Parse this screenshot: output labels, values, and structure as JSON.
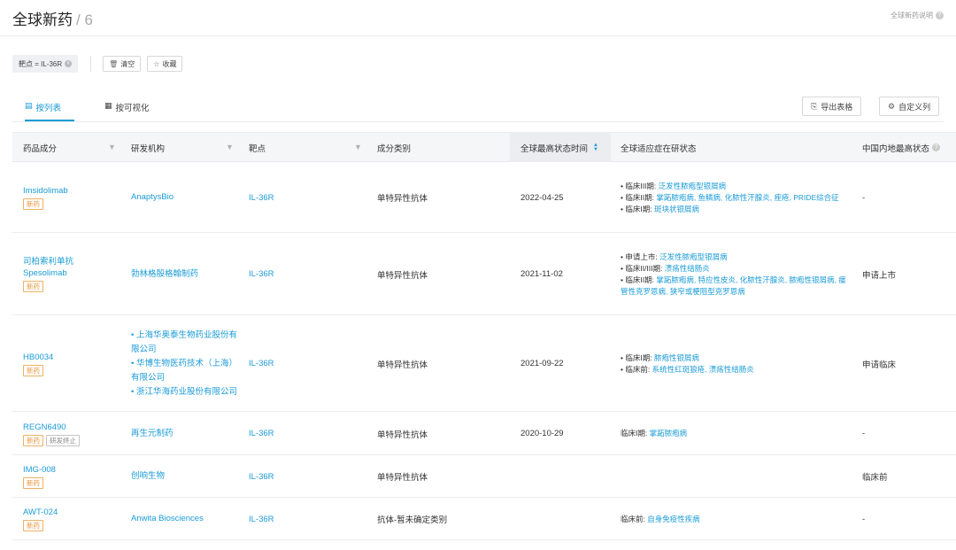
{
  "header": {
    "title": "全球新药",
    "count": "/ 6",
    "help": "全球新药说明"
  },
  "filters": {
    "chip": "靶点 = IL-36R",
    "clear": "清空",
    "save": "收藏"
  },
  "tabs": [
    {
      "label": "按列表"
    },
    {
      "label": "按可视化"
    }
  ],
  "toolbar": {
    "export": "导出表格",
    "custom_columns": "自定义列"
  },
  "columns": [
    "药品成分",
    "研发机构",
    "靶点",
    "成分类别",
    "全球最高状态时间",
    "全球适应症在研状态",
    "中国内地最高状态"
  ],
  "rows": [
    {
      "drug": [
        "Imsidolimab"
      ],
      "tags": [
        "新药"
      ],
      "orgs": [
        "AnaptysBio"
      ],
      "target": "IL-36R",
      "category": "单特异性抗体",
      "date": "2022-04-25",
      "indications": [
        {
          "phase": "• 临床III期:",
          "text": "泛发性脓疱型银屑病"
        },
        {
          "phase": "• 临床II期:",
          "text": "掌跖脓疱病, 鱼鳞病, 化脓性汗腺炎, 痤疮, PRIDE综合征"
        },
        {
          "phase": "• 临床I期:",
          "text": "斑块状银屑病"
        }
      ],
      "china": "-"
    },
    {
      "drug": [
        "司柏索利单抗",
        "Spesolimab"
      ],
      "tags": [
        "新药"
      ],
      "orgs": [
        "勃林格殷格翰制药"
      ],
      "target": "IL-36R",
      "category": "单特异性抗体",
      "date": "2021-11-02",
      "indications": [
        {
          "phase": "• 申请上市:",
          "text": "泛发性脓疱型银屑病"
        },
        {
          "phase": "• 临床II/III期:",
          "text": "溃疡性结肠炎"
        },
        {
          "phase": "• 临床II期:",
          "text": "掌跖脓疱病, 特应性皮炎, 化脓性汗腺炎, 脓疱性银屑病, 瘘管性克罗恩病, 狭窄或梗阻型克罗恩病"
        }
      ],
      "china": "申请上市"
    },
    {
      "drug": [
        "HB0034"
      ],
      "tags": [
        "新药"
      ],
      "orgs": [
        "• 上海华奥泰生物药业股份有限公司",
        "• 华博生物医药技术（上海）有限公司",
        "• 浙江华海药业股份有限公司"
      ],
      "target": "IL-36R",
      "category": "单特异性抗体",
      "date": "2021-09-22",
      "indications": [
        {
          "phase": "• 临床I期:",
          "text": "脓疱性银屑病"
        },
        {
          "phase": "• 临床前:",
          "text": "系统性红斑狼疮, 溃疡性结肠炎"
        }
      ],
      "china": "申请临床"
    },
    {
      "drug": [
        "REGN6490"
      ],
      "tags": [
        "新药",
        "研发终止"
      ],
      "orgs": [
        "再生元制药"
      ],
      "target": "IL-36R",
      "category": "单特异性抗体",
      "date": "2020-10-29",
      "indications": [
        {
          "phase": "临床I期:",
          "text": "掌跖脓疱病"
        }
      ],
      "china": "-"
    },
    {
      "drug": [
        "IMG-008"
      ],
      "tags": [
        "新药"
      ],
      "orgs": [
        "创响生物"
      ],
      "target": "IL-36R",
      "category": "单特异性抗体",
      "date": "",
      "indications": [],
      "china": "临床前"
    },
    {
      "drug": [
        "AWT-024"
      ],
      "tags": [
        "新药"
      ],
      "orgs": [
        "Anwita Biosciences"
      ],
      "target": "IL-36R",
      "category": "抗体-暂未确定类别",
      "date": "",
      "indications": [
        {
          "phase": "临床前:",
          "text": "自身免疫性疾病"
        }
      ],
      "china": "-"
    }
  ]
}
